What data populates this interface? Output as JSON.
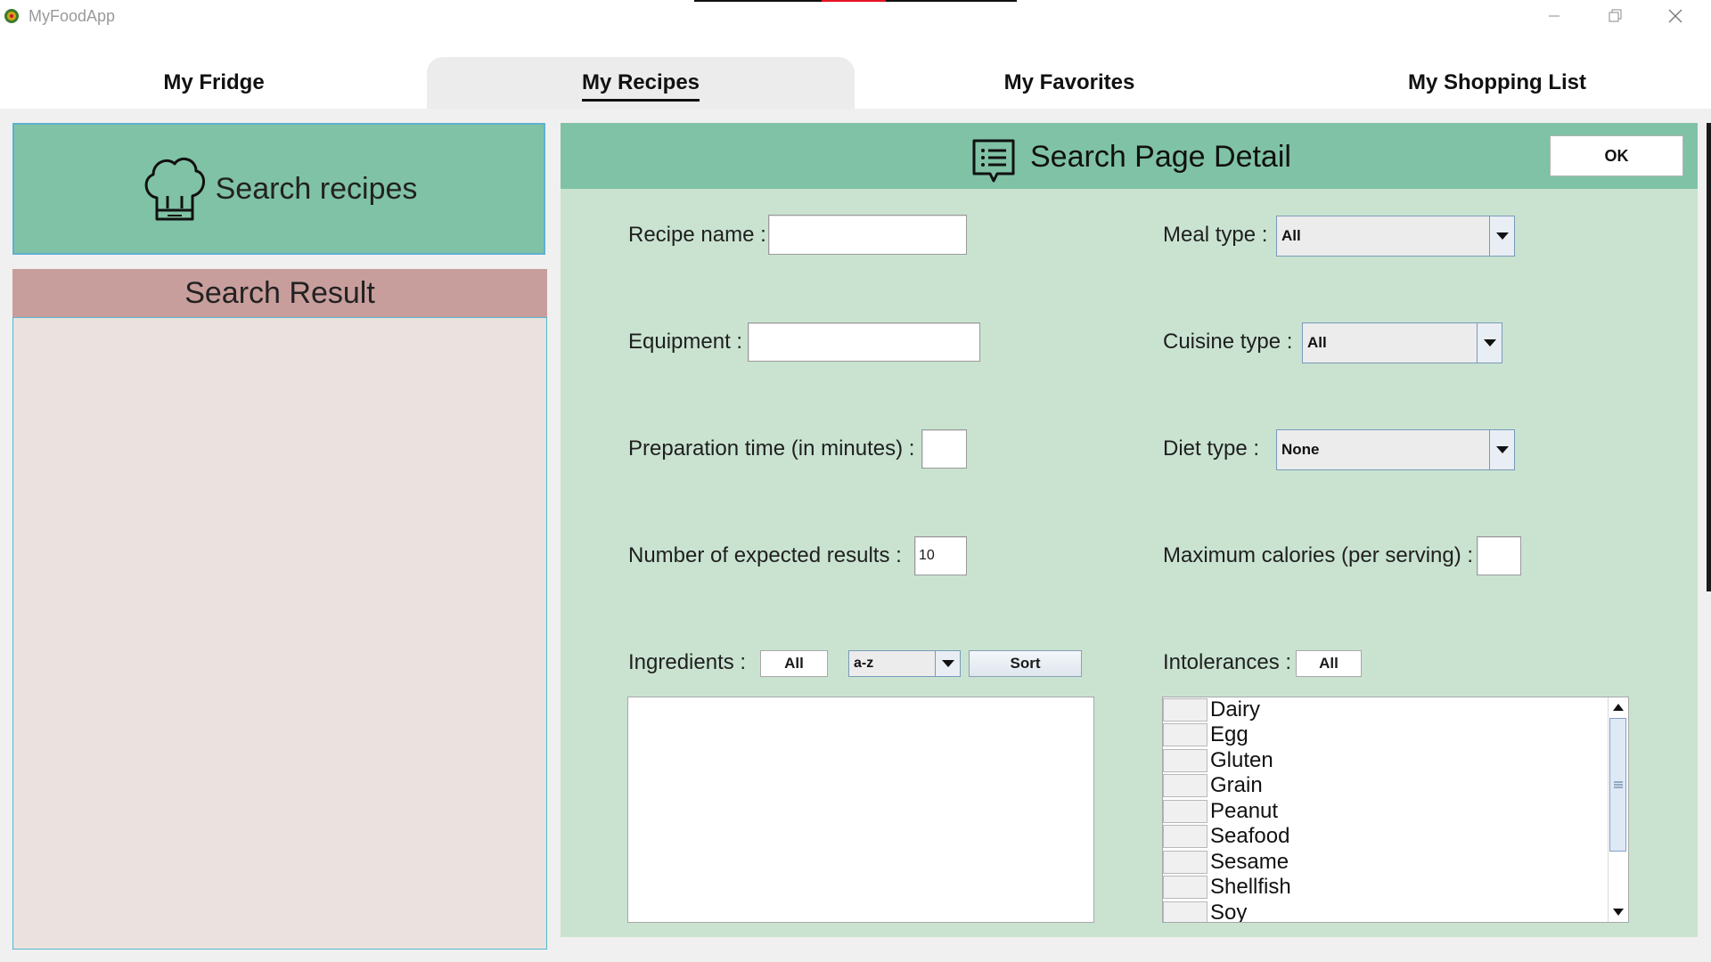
{
  "window": {
    "title": "MyFoodApp"
  },
  "tabs": [
    {
      "label": "My Fridge",
      "active": false
    },
    {
      "label": "My Recipes",
      "active": true
    },
    {
      "label": "My Favorites",
      "active": false
    },
    {
      "label": "My Shopping List",
      "active": false
    }
  ],
  "left": {
    "search_button_label": "Search recipes",
    "search_result_title": "Search Result"
  },
  "detail": {
    "title": "Search Page Detail",
    "ok_label": "OK",
    "recipe_name": {
      "label": "Recipe name :",
      "value": ""
    },
    "equipment": {
      "label": "Equipment :",
      "value": ""
    },
    "prep_time": {
      "label": "Preparation time (in minutes) :",
      "value": ""
    },
    "num_results": {
      "label": "Number of expected results :",
      "value": "10"
    },
    "meal_type": {
      "label": "Meal type :",
      "value": "All"
    },
    "cuisine_type": {
      "label": "Cuisine type :",
      "value": "All"
    },
    "diet_type": {
      "label": "Diet type :",
      "value": "None"
    },
    "max_calories": {
      "label": "Maximum calories (per serving) :",
      "value": ""
    },
    "ingredients": {
      "label": "Ingredients :",
      "all_label": "All",
      "sort_order": "a-z",
      "sort_label": "Sort",
      "items": []
    },
    "intolerances": {
      "label": "Intolerances :",
      "all_label": "All",
      "items": [
        "Dairy",
        "Egg",
        "Gluten",
        "Grain",
        "Peanut",
        "Seafood",
        "Sesame",
        "Shellfish",
        "Soy"
      ]
    }
  },
  "colors": {
    "accent_green": "#80c2a5",
    "panel_green": "#c9e3d0",
    "result_header_rose": "#c89e9c",
    "result_list_bg": "#ebe2df"
  },
  "icons": {
    "app_logo": "app-logo-icon",
    "search_button": "chef-hat-icon",
    "detail_header": "list-document-icon",
    "minimize": "minimize-icon",
    "maximize": "restore-icon",
    "close": "close-icon"
  }
}
